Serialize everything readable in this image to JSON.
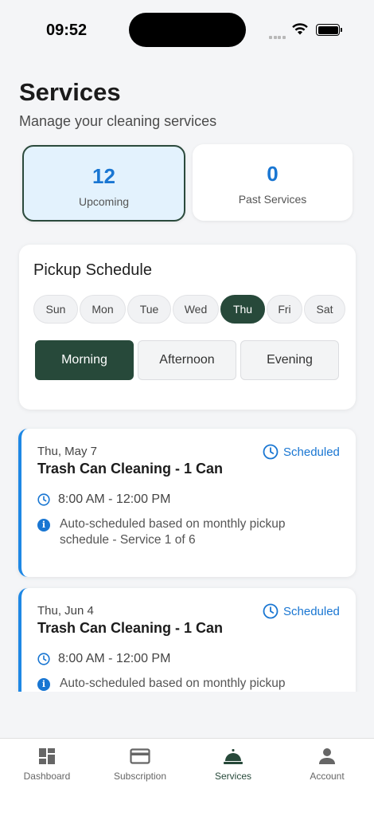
{
  "status_bar": {
    "time": "09:52"
  },
  "header": {
    "title": "Services",
    "subtitle": "Manage your cleaning services"
  },
  "stats": [
    {
      "value": "12",
      "label": "Upcoming",
      "active": true
    },
    {
      "value": "0",
      "label": "Past Services",
      "active": false
    }
  ],
  "schedule": {
    "title": "Pickup Schedule",
    "days": [
      "Sun",
      "Mon",
      "Tue",
      "Wed",
      "Thu",
      "Fri",
      "Sat"
    ],
    "selected_day": "Thu",
    "times": [
      "Morning",
      "Afternoon",
      "Evening"
    ],
    "selected_time": "Morning"
  },
  "services": [
    {
      "date": "Thu, May 7",
      "title": "Trash Can Cleaning - 1 Can",
      "status": "Scheduled",
      "time": "8:00 AM - 12:00 PM",
      "note": "Auto-scheduled based on monthly pickup schedule - Service 1 of 6"
    },
    {
      "date": "Thu, Jun 4",
      "title": "Trash Can Cleaning - 1 Can",
      "status": "Scheduled",
      "time": "8:00 AM - 12:00 PM",
      "note": "Auto-scheduled based on monthly pickup"
    }
  ],
  "nav": [
    {
      "label": "Dashboard",
      "icon": "dashboard-icon"
    },
    {
      "label": "Subscription",
      "icon": "credit-card-icon"
    },
    {
      "label": "Services",
      "icon": "service-bell-icon",
      "active": true
    },
    {
      "label": "Account",
      "icon": "person-icon"
    }
  ],
  "colors": {
    "primary": "#27493a",
    "accent": "#1976d2",
    "background": "#f4f5f7"
  }
}
